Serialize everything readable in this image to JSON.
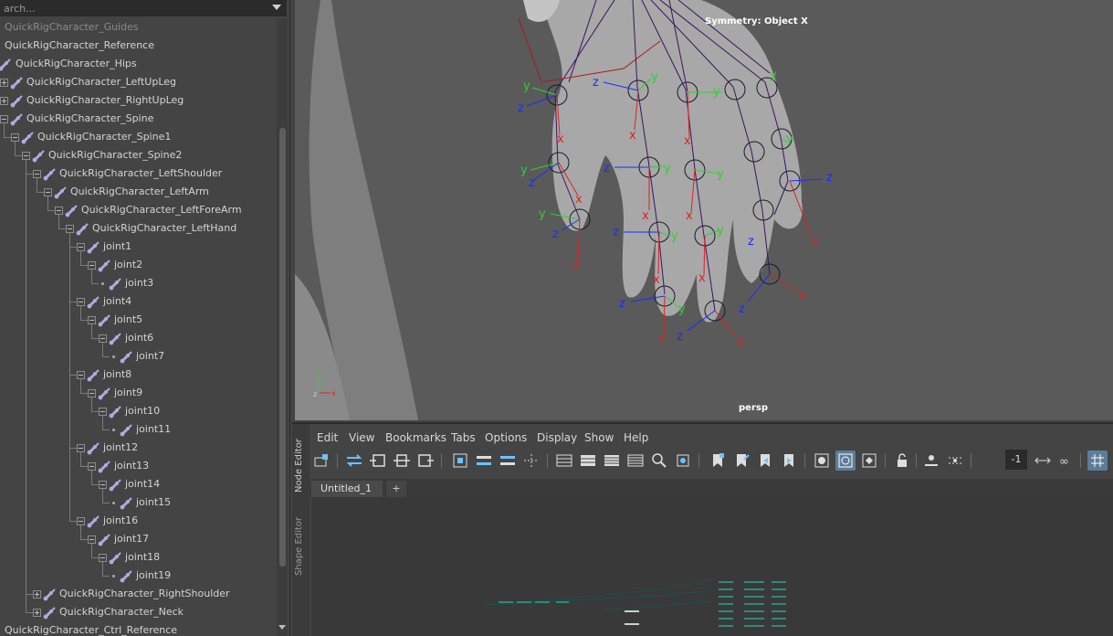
{
  "outliner": {
    "search_text": "arch...",
    "rows": [
      {
        "label": "QuickRigCharacter_Guides",
        "depth": 0,
        "dim": true
      },
      {
        "label": "QuickRigCharacter_Reference",
        "depth": 0
      },
      {
        "label": "QuickRigCharacter_Hips",
        "depth": 0,
        "icon": true
      },
      {
        "label": "QuickRigCharacter_LeftUpLeg",
        "depth": 1,
        "icon": true,
        "exp": "plus"
      },
      {
        "label": "QuickRigCharacter_RightUpLeg",
        "depth": 1,
        "icon": true,
        "exp": "plus"
      },
      {
        "label": "QuickRigCharacter_Spine",
        "depth": 1,
        "icon": true,
        "exp": "minus"
      },
      {
        "label": "QuickRigCharacter_Spine1",
        "depth": 2,
        "icon": true,
        "exp": "minus"
      },
      {
        "label": "QuickRigCharacter_Spine2",
        "depth": 3,
        "icon": true,
        "exp": "minus"
      },
      {
        "label": "QuickRigCharacter_LeftShoulder",
        "depth": 4,
        "icon": true,
        "exp": "minus"
      },
      {
        "label": "QuickRigCharacter_LeftArm",
        "depth": 5,
        "icon": true,
        "exp": "minus"
      },
      {
        "label": "QuickRigCharacter_LeftForeArm",
        "depth": 6,
        "icon": true,
        "exp": "minus"
      },
      {
        "label": "QuickRigCharacter_LeftHand",
        "depth": 7,
        "icon": true,
        "exp": "minus"
      },
      {
        "label": "joint1",
        "depth": 8,
        "icon": true,
        "exp": "minus"
      },
      {
        "label": "joint2",
        "depth": 9,
        "icon": true,
        "exp": "minus"
      },
      {
        "label": "joint3",
        "depth": 10,
        "icon": true,
        "exp": "leaf"
      },
      {
        "label": "joint4",
        "depth": 8,
        "icon": true,
        "exp": "minus"
      },
      {
        "label": "joint5",
        "depth": 9,
        "icon": true,
        "exp": "minus"
      },
      {
        "label": "joint6",
        "depth": 10,
        "icon": true,
        "exp": "minus"
      },
      {
        "label": "joint7",
        "depth": 11,
        "icon": true,
        "exp": "leaf"
      },
      {
        "label": "joint8",
        "depth": 8,
        "icon": true,
        "exp": "minus"
      },
      {
        "label": "joint9",
        "depth": 9,
        "icon": true,
        "exp": "minus"
      },
      {
        "label": "joint10",
        "depth": 10,
        "icon": true,
        "exp": "minus"
      },
      {
        "label": "joint11",
        "depth": 11,
        "icon": true,
        "exp": "leaf"
      },
      {
        "label": "joint12",
        "depth": 8,
        "icon": true,
        "exp": "minus"
      },
      {
        "label": "joint13",
        "depth": 9,
        "icon": true,
        "exp": "minus"
      },
      {
        "label": "joint14",
        "depth": 10,
        "icon": true,
        "exp": "minus"
      },
      {
        "label": "joint15",
        "depth": 11,
        "icon": true,
        "exp": "leaf"
      },
      {
        "label": "joint16",
        "depth": 8,
        "icon": true,
        "exp": "minus"
      },
      {
        "label": "joint17",
        "depth": 9,
        "icon": true,
        "exp": "minus"
      },
      {
        "label": "joint18",
        "depth": 10,
        "icon": true,
        "exp": "minus"
      },
      {
        "label": "joint19",
        "depth": 11,
        "icon": true,
        "exp": "leaf"
      },
      {
        "label": "QuickRigCharacter_RightShoulder",
        "depth": 4,
        "icon": true,
        "exp": "plus"
      },
      {
        "label": "QuickRigCharacter_Neck",
        "depth": 4,
        "icon": true,
        "exp": "plus"
      },
      {
        "label": "QuickRigCharacter_Ctrl_Reference",
        "depth": 0
      }
    ]
  },
  "viewport": {
    "symmetry_label": "Symmetry: Object X",
    "camera_label": "persp",
    "axis_labels": {
      "x": "x",
      "y": "y",
      "z": "z"
    }
  },
  "node_editor": {
    "side_tabs": [
      "Node Editor",
      "Shape Editor"
    ],
    "menus": [
      "Edit",
      "View",
      "Bookmarks",
      "Tabs",
      "Options",
      "Display",
      "Show",
      "Help"
    ],
    "tabs": [
      "Untitled_1"
    ],
    "add_tab_label": "+",
    "numeric_field": "-1"
  },
  "colors": {
    "joint_icon": "#b4a8e0",
    "axis_x": "#e02020",
    "axis_y": "#30d030",
    "axis_z": "#1a2cff",
    "bone": "#3a1460",
    "toolbar_active": "#5d7d99"
  }
}
